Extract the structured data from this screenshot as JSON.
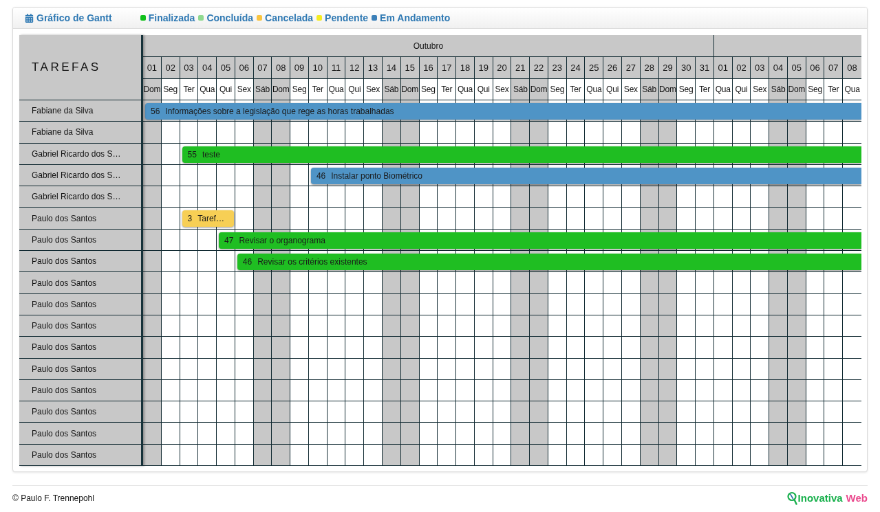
{
  "header": {
    "title": "Gráfico de Gantt"
  },
  "legend": [
    {
      "label": "Finalizada",
      "color": "#10c01b"
    },
    {
      "label": "Concluída",
      "color": "#8fd98f"
    },
    {
      "label": "Cancelada",
      "color": "#f9c440"
    },
    {
      "label": "Pendente",
      "color": "#f5ec22"
    },
    {
      "label": "Em Andamento",
      "color": "#3b7fb8"
    }
  ],
  "tasks_heading": "TAREFAS",
  "timeline": {
    "months": [
      {
        "name": "Outubro",
        "days": [
          {
            "number": "01",
            "weekday": "Dom",
            "weekend": true
          },
          {
            "number": "02",
            "weekday": "Seg",
            "weekend": false
          },
          {
            "number": "03",
            "weekday": "Ter",
            "weekend": false
          },
          {
            "number": "04",
            "weekday": "Qua",
            "weekend": false
          },
          {
            "number": "05",
            "weekday": "Qui",
            "weekend": false
          },
          {
            "number": "06",
            "weekday": "Sex",
            "weekend": false
          },
          {
            "number": "07",
            "weekday": "Sáb",
            "weekend": true
          },
          {
            "number": "08",
            "weekday": "Dom",
            "weekend": true
          },
          {
            "number": "09",
            "weekday": "Seg",
            "weekend": false
          },
          {
            "number": "10",
            "weekday": "Ter",
            "weekend": false
          },
          {
            "number": "11",
            "weekday": "Qua",
            "weekend": false
          },
          {
            "number": "12",
            "weekday": "Qui",
            "weekend": false
          },
          {
            "number": "13",
            "weekday": "Sex",
            "weekend": false
          },
          {
            "number": "14",
            "weekday": "Sáb",
            "weekend": true
          },
          {
            "number": "15",
            "weekday": "Dom",
            "weekend": true
          },
          {
            "number": "16",
            "weekday": "Seg",
            "weekend": false
          },
          {
            "number": "17",
            "weekday": "Ter",
            "weekend": false
          },
          {
            "number": "18",
            "weekday": "Qua",
            "weekend": false
          },
          {
            "number": "19",
            "weekday": "Qui",
            "weekend": false
          },
          {
            "number": "20",
            "weekday": "Sex",
            "weekend": false
          },
          {
            "number": "21",
            "weekday": "Sáb",
            "weekend": true
          },
          {
            "number": "22",
            "weekday": "Dom",
            "weekend": true
          },
          {
            "number": "23",
            "weekday": "Seg",
            "weekend": false
          },
          {
            "number": "24",
            "weekday": "Ter",
            "weekend": false
          },
          {
            "number": "25",
            "weekday": "Qua",
            "weekend": false
          },
          {
            "number": "26",
            "weekday": "Qui",
            "weekend": false
          },
          {
            "number": "27",
            "weekday": "Sex",
            "weekend": false
          },
          {
            "number": "28",
            "weekday": "Sáb",
            "weekend": true
          },
          {
            "number": "29",
            "weekday": "Dom",
            "weekend": true
          },
          {
            "number": "30",
            "weekday": "Seg",
            "weekend": false
          },
          {
            "number": "31",
            "weekday": "Ter",
            "weekend": false
          }
        ]
      },
      {
        "days": [
          {
            "number": "01",
            "weekday": "Qua",
            "weekend": false
          },
          {
            "number": "02",
            "weekday": "Qui",
            "weekend": false
          },
          {
            "number": "03",
            "weekday": "Sex",
            "weekend": false
          },
          {
            "number": "04",
            "weekday": "Sáb",
            "weekend": true
          },
          {
            "number": "05",
            "weekday": "Dom",
            "weekend": true
          },
          {
            "number": "06",
            "weekday": "Seg",
            "weekend": false
          },
          {
            "number": "07",
            "weekday": "Ter",
            "weekend": false
          },
          {
            "number": "08",
            "weekday": "Qua",
            "weekend": false
          }
        ]
      }
    ]
  },
  "rows": [
    {
      "name": "Fabiane da Silva",
      "timeline": [
        {
          "kind": "task",
          "id": "56",
          "title": "Informações sobre a legislação que rege as horas trabalhadas",
          "color": "#4f94c6",
          "level": 1
        }
      ]
    },
    {
      "name": "Fabiane da Silva"
    },
    {
      "name": "Gabriel Ricardo dos S…",
      "timeline": [
        {
          "kind": "blank"
        },
        {
          "kind": "blank"
        },
        {
          "kind": "task",
          "id": "55",
          "title": "teste",
          "color": "#1fbe22",
          "level": 0.94872
        }
      ]
    },
    {
      "name": "Gabriel Ricardo dos S…",
      "timeline": [
        {
          "kind": "blank"
        },
        {
          "kind": "blank"
        },
        {
          "kind": "blank"
        },
        {
          "kind": "blank"
        },
        {
          "kind": "blank"
        },
        {
          "kind": "blank"
        },
        {
          "kind": "blank"
        },
        {
          "kind": "blank"
        },
        {
          "kind": "blank"
        },
        {
          "kind": "task",
          "id": "46",
          "title": "Instalar ponto Biométrico",
          "color": "#4f94c6",
          "level": 0.76923
        }
      ]
    },
    {
      "name": "Gabriel Ricardo dos S…"
    },
    {
      "name": "Paulo dos Santos",
      "timeline": [
        {
          "kind": "blank"
        },
        {
          "kind": "blank"
        },
        {
          "kind": "task",
          "id": "3",
          "title": "Taref…",
          "color": "#f7cf55",
          "level": 0.07692
        }
      ]
    },
    {
      "name": "Paulo dos Santos",
      "timeline": [
        {
          "kind": "blank"
        },
        {
          "kind": "blank"
        },
        {
          "kind": "blank"
        },
        {
          "kind": "blank"
        },
        {
          "kind": "task",
          "id": "47",
          "title": "Revisar o organograma",
          "color": "#1fbe22",
          "level": 0.89744
        }
      ]
    },
    {
      "name": "Paulo dos Santos",
      "timeline": [
        {
          "kind": "blank"
        },
        {
          "kind": "blank"
        },
        {
          "kind": "blank"
        },
        {
          "kind": "blank"
        },
        {
          "kind": "blank"
        },
        {
          "kind": "task",
          "id": "46",
          "title": "Revisar os critérios existentes",
          "color": "#1fbe22",
          "level": 0.87179
        }
      ]
    },
    {
      "name": "Paulo dos Santos"
    },
    {
      "name": "Paulo dos Santos"
    },
    {
      "name": "Paulo dos Santos"
    },
    {
      "name": "Paulo dos Santos"
    },
    {
      "name": "Paulo dos Santos"
    },
    {
      "name": "Paulo dos Santos"
    },
    {
      "name": "Paulo dos Santos"
    },
    {
      "name": "Paulo dos Santos"
    },
    {
      "name": "Paulo dos Santos"
    }
  ],
  "footer": {
    "copyright": "© Paulo F. Trennepohl",
    "brand": {
      "name": "Inovativa",
      "suffix": "Web"
    }
  }
}
